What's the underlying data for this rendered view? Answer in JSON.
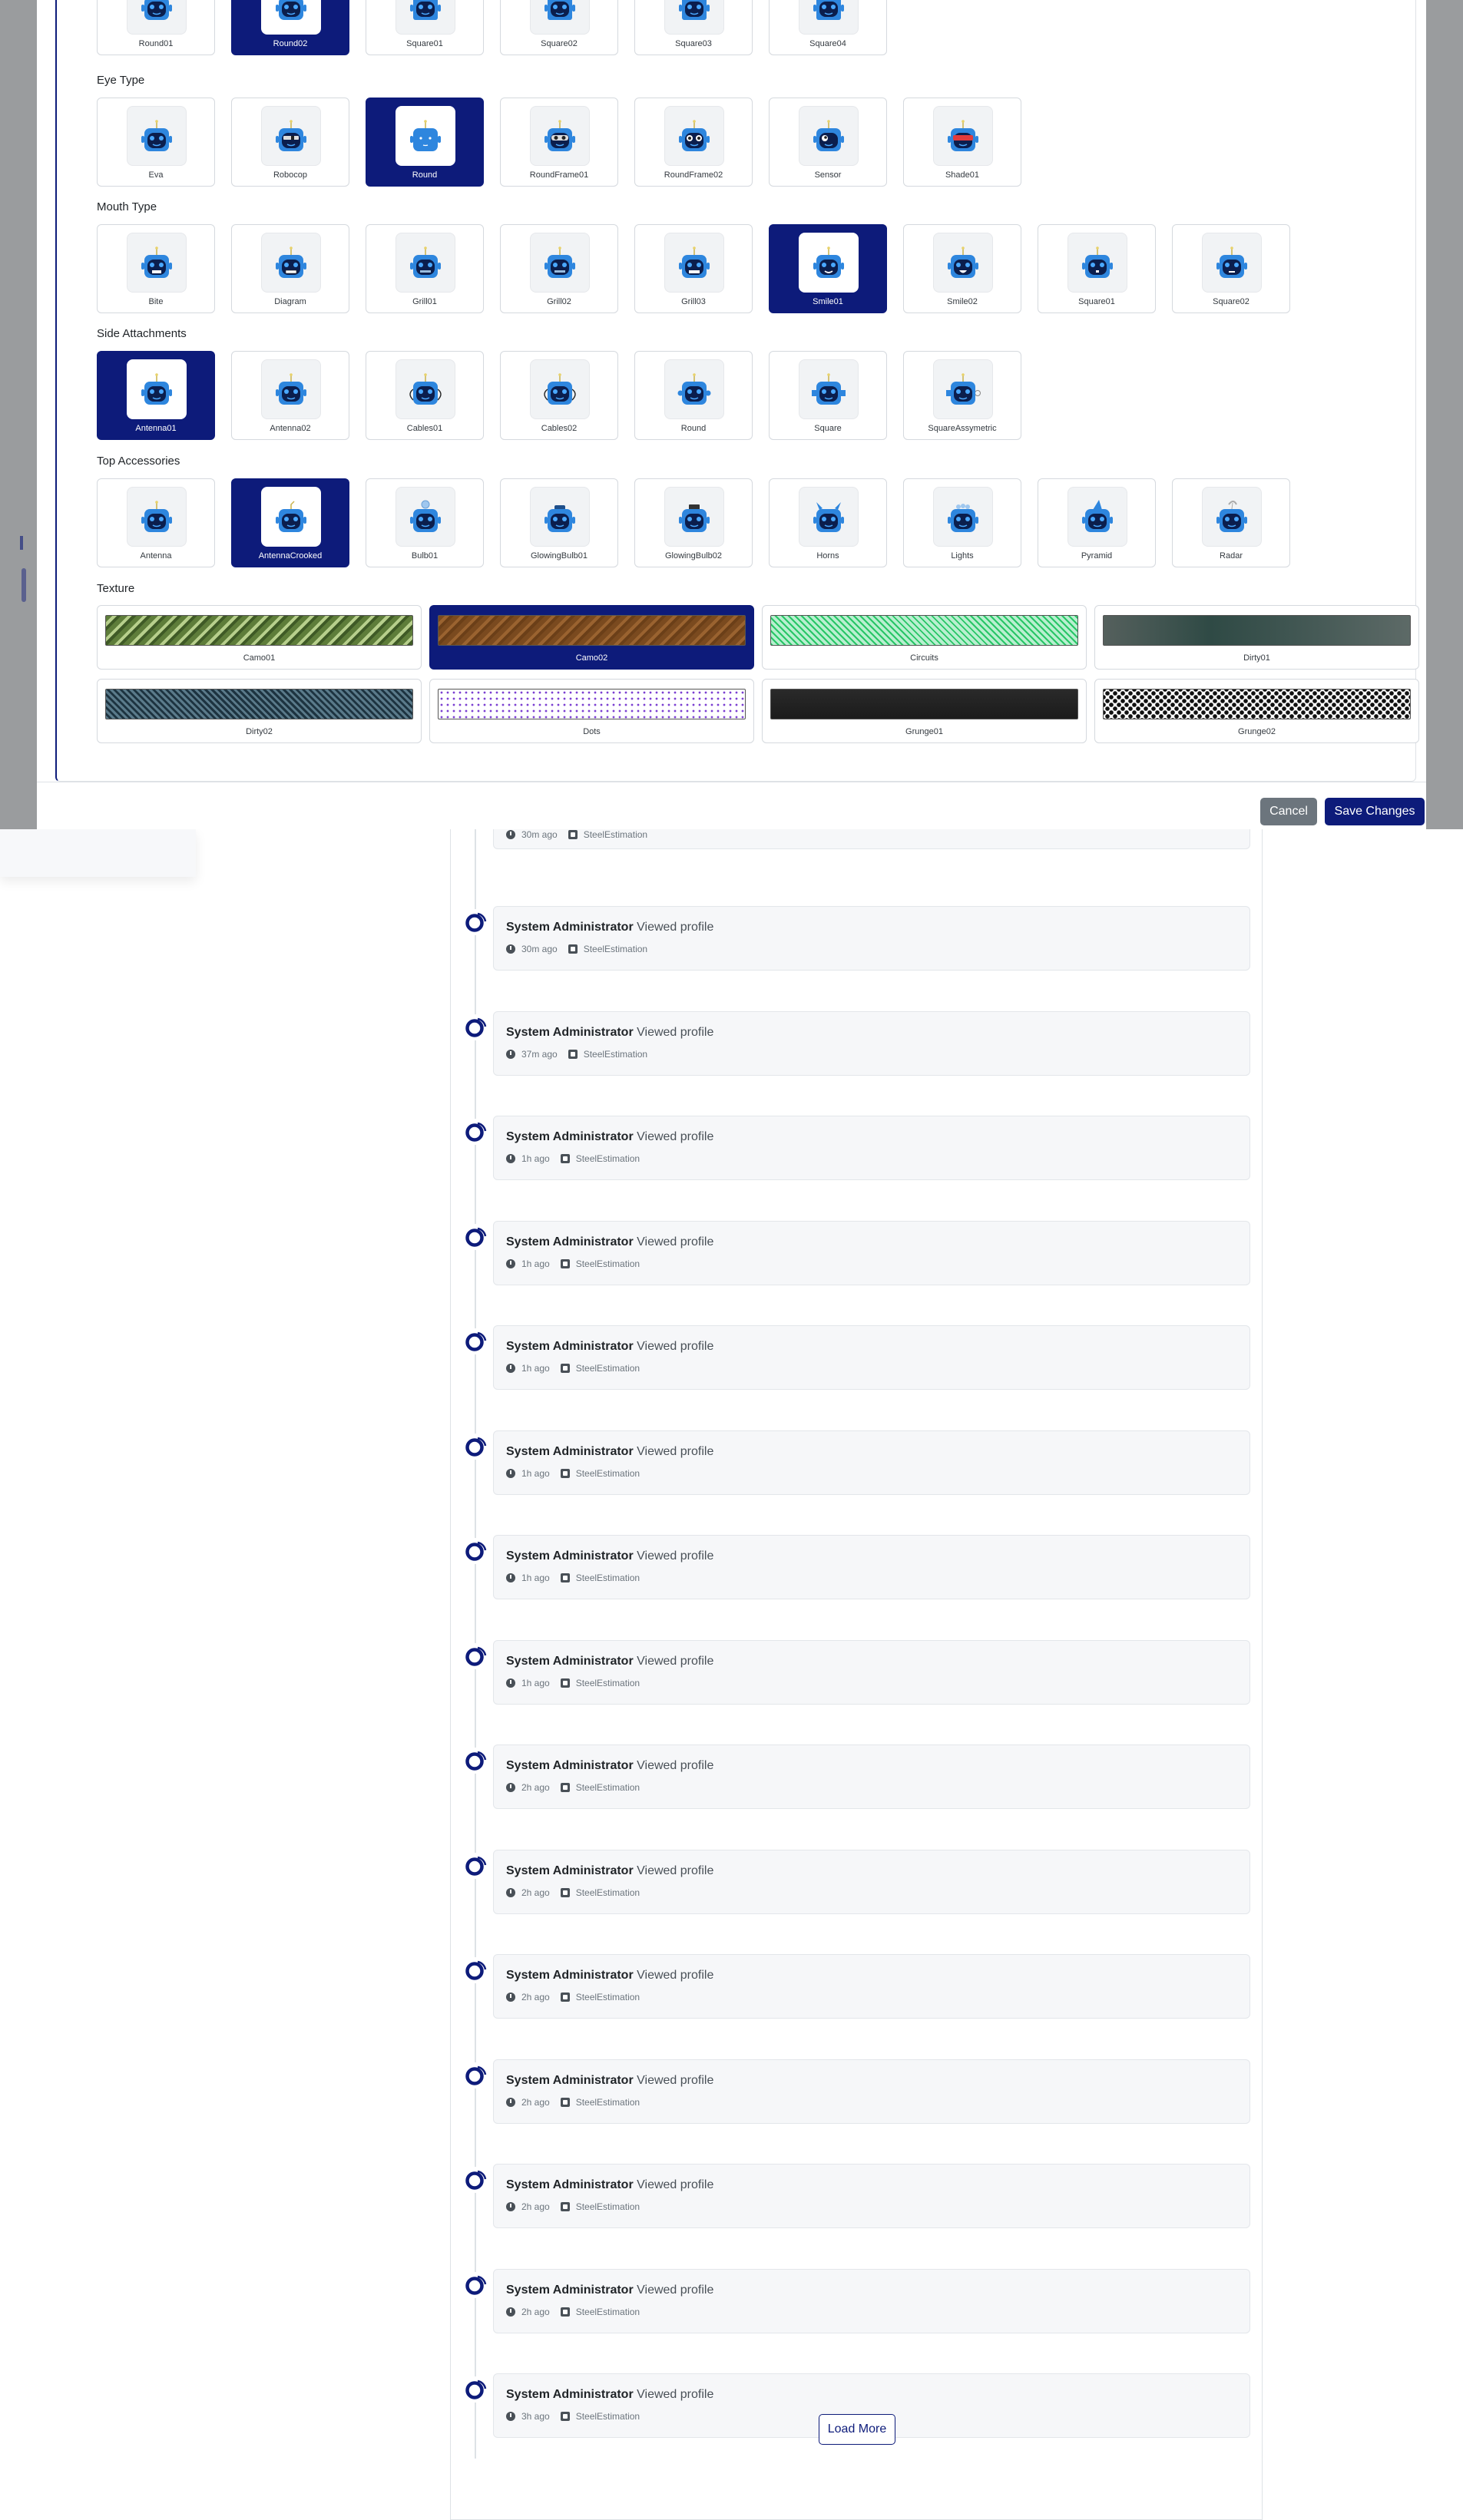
{
  "modal": {
    "rows": {
      "face_shape": [
        "Round01",
        "Round02",
        "Square01",
        "Square02",
        "Square03",
        "Square04"
      ],
      "eye_type": [
        "Eva",
        "Robocop",
        "Round",
        "RoundFrame01",
        "RoundFrame02",
        "Sensor",
        "Shade01"
      ],
      "mouth_type": [
        "Bite",
        "Diagram",
        "Grill01",
        "Grill02",
        "Grill03",
        "Smile01",
        "Smile02",
        "Square01",
        "Square02"
      ],
      "side_attachments": [
        "Antenna01",
        "Antenna02",
        "Cables01",
        "Cables02",
        "Round",
        "Square",
        "SquareAssymetric"
      ],
      "top_accessories": [
        "Antenna",
        "AntennaCrooked",
        "Bulb01",
        "GlowingBulb01",
        "GlowingBulb02",
        "Horns",
        "Lights",
        "Pyramid",
        "Radar"
      ],
      "texture": [
        "Camo01",
        "Camo02",
        "Circuits",
        "Dirty01",
        "Dirty02",
        "Dots",
        "Grunge01",
        "Grunge02"
      ]
    },
    "selected": {
      "face_shape": "Round02",
      "eye_type": "Round",
      "mouth_type": "Smile01",
      "side_attachments": "Antenna01",
      "top_accessories": "AntennaCrooked",
      "texture": "Camo02"
    },
    "labels": {
      "eye_type": "Eye Type",
      "mouth_type": "Mouth Type",
      "side_attachments": "Side Attachments",
      "top_accessories": "Top Accessories",
      "texture": "Texture"
    },
    "footer": {
      "cancel": "Cancel",
      "save": "Save Changes"
    }
  },
  "timeline": {
    "partial_item": {
      "time": "30m ago",
      "source": "SteelEstimation"
    },
    "items": [
      {
        "user": "System Administrator",
        "action": "Viewed profile",
        "time": "30m ago",
        "source": "SteelEstimation"
      },
      {
        "user": "System Administrator",
        "action": "Viewed profile",
        "time": "37m ago",
        "source": "SteelEstimation"
      },
      {
        "user": "System Administrator",
        "action": "Viewed profile",
        "time": "1h ago",
        "source": "SteelEstimation"
      },
      {
        "user": "System Administrator",
        "action": "Viewed profile",
        "time": "1h ago",
        "source": "SteelEstimation"
      },
      {
        "user": "System Administrator",
        "action": "Viewed profile",
        "time": "1h ago",
        "source": "SteelEstimation"
      },
      {
        "user": "System Administrator",
        "action": "Viewed profile",
        "time": "1h ago",
        "source": "SteelEstimation"
      },
      {
        "user": "System Administrator",
        "action": "Viewed profile",
        "time": "1h ago",
        "source": "SteelEstimation"
      },
      {
        "user": "System Administrator",
        "action": "Viewed profile",
        "time": "1h ago",
        "source": "SteelEstimation"
      },
      {
        "user": "System Administrator",
        "action": "Viewed profile",
        "time": "2h ago",
        "source": "SteelEstimation"
      },
      {
        "user": "System Administrator",
        "action": "Viewed profile",
        "time": "2h ago",
        "source": "SteelEstimation"
      },
      {
        "user": "System Administrator",
        "action": "Viewed profile",
        "time": "2h ago",
        "source": "SteelEstimation"
      },
      {
        "user": "System Administrator",
        "action": "Viewed profile",
        "time": "2h ago",
        "source": "SteelEstimation"
      },
      {
        "user": "System Administrator",
        "action": "Viewed profile",
        "time": "2h ago",
        "source": "SteelEstimation"
      },
      {
        "user": "System Administrator",
        "action": "Viewed profile",
        "time": "2h ago",
        "source": "SteelEstimation"
      },
      {
        "user": "System Administrator",
        "action": "Viewed profile",
        "time": "3h ago",
        "source": "SteelEstimation"
      }
    ],
    "load_more": "Load More"
  },
  "colors": {
    "primary": "#0d1b7a",
    "robot_blue": "#2e86de",
    "secondary": "#6c757d"
  }
}
